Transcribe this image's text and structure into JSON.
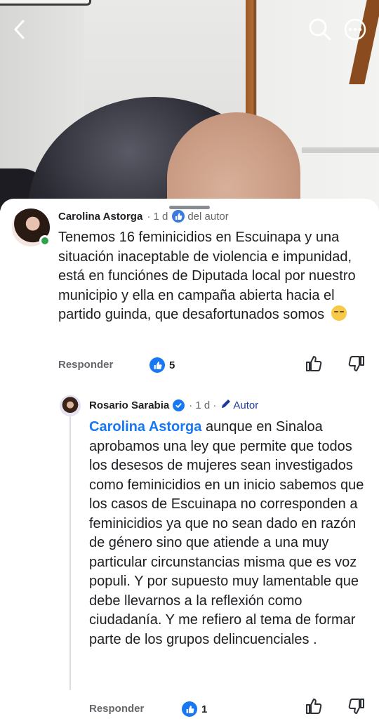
{
  "header": {
    "back_icon": "chevron-left-icon",
    "search_icon": "search-icon",
    "more_icon": "more-horizontal-icon"
  },
  "comment": {
    "author": "Carolina Astorga",
    "time": "· 1 d",
    "badge_label": "del autor",
    "text": "Tenemos 16 feminicidios en Escuinapa y una situación inaceptable de violencia e impunidad,  está en funciónes de Diputada local por nuestro municipio y ella en campaña abierta hacia el partido guinda, que desafortunados somos",
    "reply_label": "Responder",
    "reaction_count": "5"
  },
  "reply": {
    "author": "Rosario Sarabia",
    "time": "· 1 d ·",
    "badge_label": "Autor",
    "mention": "Carolina Astorga",
    "text": " aunque en Sinaloa aprobamos una ley que permite que todos los desesos de mujeres sean investigados como feminicidios en un inicio sabemos que los casos de Escuinapa no corresponden a feminicidios ya que no sean dado en razón de género sino que atiende a una muy particular circunstancias  misma que es voz populi. Y por supuesto muy lamentable que debe llevarnos a la reflexión como ciudadanía. Y me refiero al tema de formar parte de los grupos delincuenciales .",
    "reply_label": "Responder",
    "reaction_count": "1"
  },
  "colors": {
    "accent": "#1877f2",
    "author_tag": "#1d3c9e",
    "secondary_text": "#65676b",
    "online": "#31a24c"
  }
}
